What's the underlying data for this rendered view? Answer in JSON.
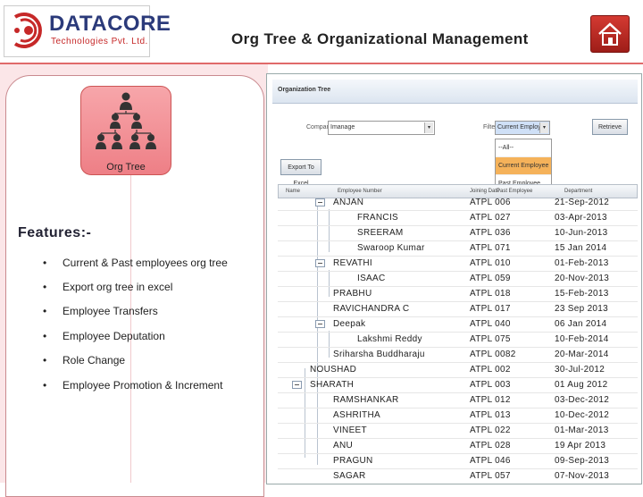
{
  "header": {
    "logo_name": "DATACORE",
    "logo_sub": "Technologies Pvt. Ltd.",
    "title": "Org Tree & Organizational Management",
    "home_icon": "home-icon"
  },
  "left": {
    "card_label": "Org Tree",
    "card_icon": "org-chart-icon",
    "features_title": "Features:-",
    "features": [
      "Current & Past employees  org tree",
      "Export org tree in excel",
      "Employee Transfers",
      "Employee Deputation",
      "Role Change",
      "Employee Promotion & Increment"
    ]
  },
  "app": {
    "panel_title": "Organization Tree",
    "company_label": "Company",
    "company_value": "Imanage",
    "filter_label": "Filter",
    "filter_value": "Current Employee",
    "retrieve_label": "Retrieve",
    "export_label": "Export To Excel",
    "filter_options": [
      "--All--",
      "Current Employee",
      "Past Employee"
    ],
    "columns": [
      "Name",
      "Employee Number",
      "Joining Date",
      "Past Employee",
      "Department"
    ],
    "rows": [
      {
        "name": "ANJAN",
        "emp": "ATPL 006",
        "date": "21-Sep-2012"
      },
      {
        "name": "FRANCIS",
        "emp": "ATPL 027",
        "date": "03-Apr-2013"
      },
      {
        "name": "SREERAM",
        "emp": "ATPL 036",
        "date": "10-Jun-2013"
      },
      {
        "name": "Swaroop Kumar",
        "emp": "ATPL 071",
        "date": "15 Jan 2014"
      },
      {
        "name": "REVATHI",
        "emp": "ATPL 010",
        "date": "01-Feb-2013"
      },
      {
        "name": "ISAAC",
        "emp": "ATPL 059",
        "date": "20-Nov-2013"
      },
      {
        "name": "PRABHU",
        "emp": "ATPL 018",
        "date": "15-Feb-2013"
      },
      {
        "name": "RAVICHANDRA C",
        "emp": "ATPL 017",
        "date": "23 Sep 2013"
      },
      {
        "name": "Deepak",
        "emp": "ATPL 040",
        "date": "06 Jan 2014"
      },
      {
        "name": "Lakshmi Reddy",
        "emp": "ATPL 075",
        "date": "10-Feb-2014"
      },
      {
        "name": "Sriharsha Buddharaju",
        "emp": "ATPL 0082",
        "date": "20-Mar-2014"
      },
      {
        "name": "NOUSHAD",
        "emp": "ATPL 002",
        "date": "30-Jul-2012"
      },
      {
        "name": "SHARATH",
        "emp": "ATPL 003",
        "date": "01 Aug 2012"
      },
      {
        "name": "RAMSHANKAR",
        "emp": "ATPL 012",
        "date": "03-Dec-2012"
      },
      {
        "name": "ASHRITHA",
        "emp": "ATPL 013",
        "date": "10-Dec-2012"
      },
      {
        "name": "VINEET",
        "emp": "ATPL 022",
        "date": "01-Mar-2013"
      },
      {
        "name": "ANU",
        "emp": "ATPL 028",
        "date": "19 Apr 2013"
      },
      {
        "name": "PRAGUN",
        "emp": "ATPL 046",
        "date": "09-Sep-2013"
      },
      {
        "name": "SAGAR",
        "emp": "ATPL 057",
        "date": "07-Nov-2013"
      }
    ]
  }
}
